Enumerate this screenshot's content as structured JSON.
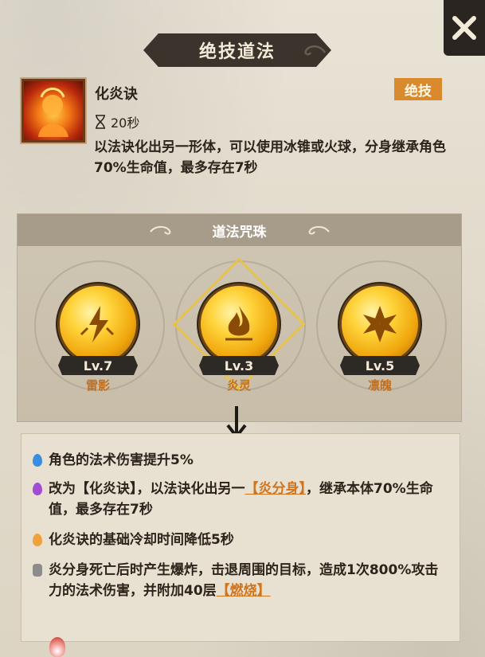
{
  "header": {
    "title": "绝技道法"
  },
  "skill": {
    "name": "化炎诀",
    "badge": "绝技",
    "cooldown": "20秒",
    "description": "以法诀化出另一形体，可以使用冰锥或火球，分身继承角色70%生命值，最多存在7秒"
  },
  "beads": {
    "title": "道法咒珠",
    "items": [
      {
        "level": "Lv.7",
        "name": "雷影",
        "icon": "lightning-icon"
      },
      {
        "level": "Lv.3",
        "name": "炎灵",
        "icon": "flame-icon",
        "selected": true
      },
      {
        "level": "Lv.5",
        "name": "凛魄",
        "icon": "snowflake-icon"
      }
    ]
  },
  "effects": {
    "e1": {
      "text": "角色的法术伤害提升5%",
      "gem_color": "#3a8ee0"
    },
    "e2": {
      "pre": "改为【化炎诀】，以法诀化出另一",
      "keyword": "【炎分身】",
      "post": "，继承本体70%生命值，最多存在7秒",
      "gem_color": "#a24cd6"
    },
    "e3": {
      "text": "化炎诀的基础冷却时间降低5秒",
      "gem_color": "#f0a23a"
    },
    "e4": {
      "pre": "炎分身死亡后时产生爆炸，击退周围的目标，造成1次800%攻击力的法术伤害，并附加40层",
      "keyword": "【燃烧】",
      "gem_color": "#8c8c8c"
    }
  },
  "colors": {
    "accent": "#d88a2c",
    "keyword": "#d0741e",
    "dark_plate": "#3b342c"
  }
}
